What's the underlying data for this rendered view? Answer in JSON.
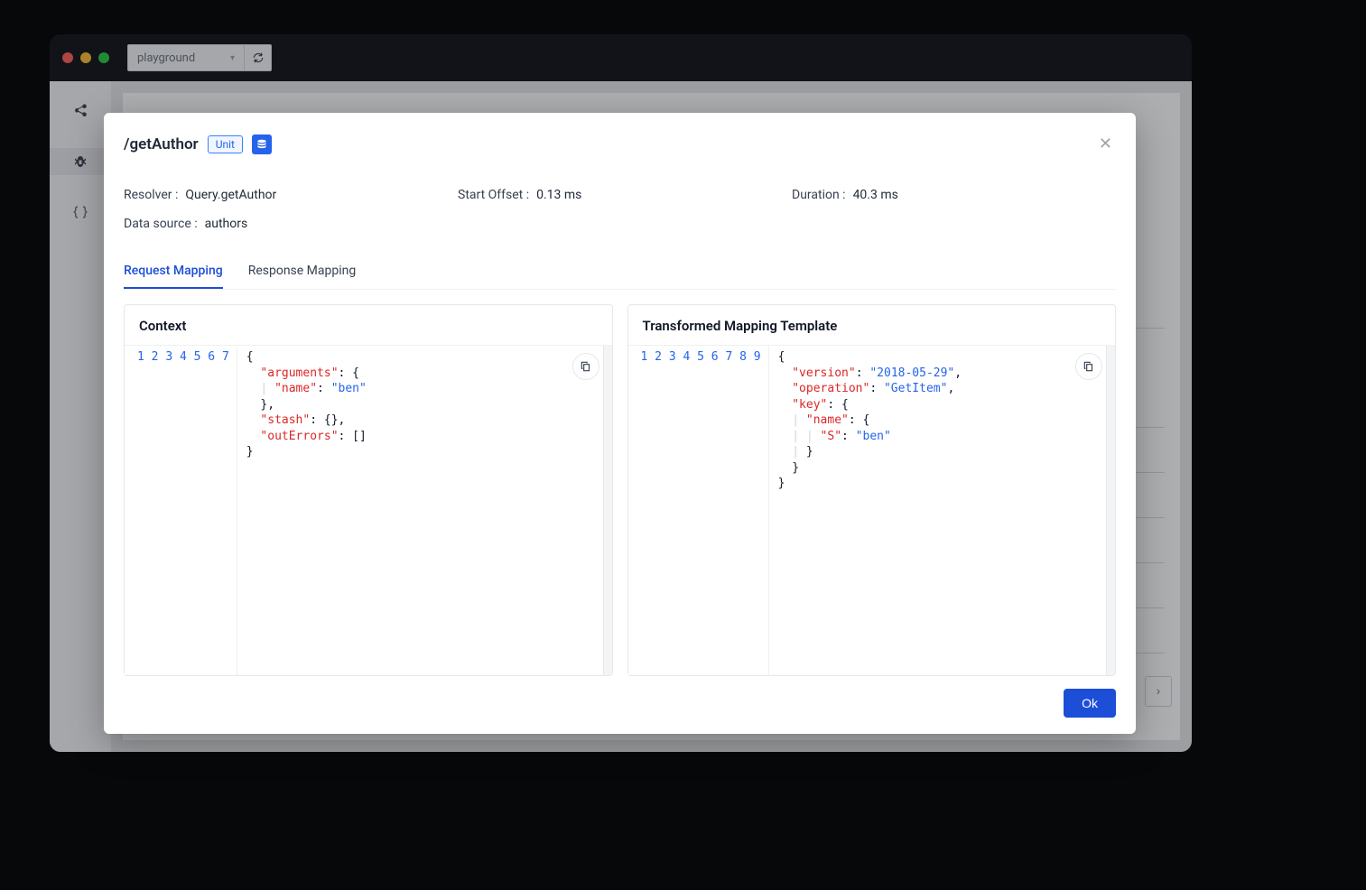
{
  "titlebar": {
    "dropdown_value": "playground"
  },
  "modal": {
    "title": "/getAuthor",
    "badge": "Unit",
    "resolver_label": "Resolver :",
    "resolver_value": "Query.getAuthor",
    "offset_label": "Start Offset :",
    "offset_value": "0.13 ms",
    "duration_label": "Duration :",
    "duration_value": "40.3 ms",
    "datasource_label": "Data source :",
    "datasource_value": "authors",
    "tabs": {
      "request": "Request Mapping",
      "response": "Response Mapping"
    },
    "left_panel_title": "Context",
    "right_panel_title": "Transformed Mapping Template",
    "context_lines": [
      "1",
      "2",
      "3",
      "4",
      "5",
      "6",
      "7"
    ],
    "template_lines": [
      "1",
      "2",
      "3",
      "4",
      "5",
      "6",
      "7",
      "8",
      "9"
    ],
    "context_json": {
      "arguments": {
        "name": "ben"
      },
      "stash": {},
      "outErrors": []
    },
    "template_json": {
      "version": "2018-05-29",
      "operation": "GetItem",
      "key": {
        "name": {
          "S": "ben"
        }
      }
    },
    "ok_label": "Ok"
  }
}
